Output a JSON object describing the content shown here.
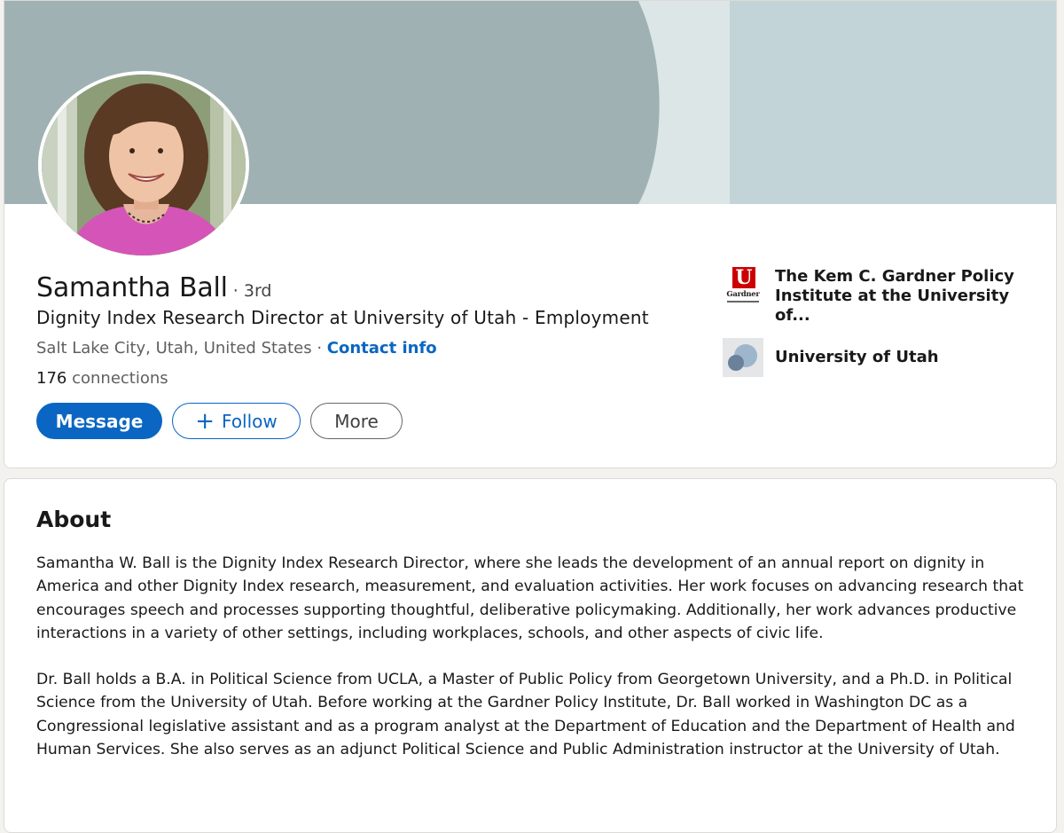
{
  "profile": {
    "name": "Samantha Ball",
    "degree": "· 3rd",
    "headline": "Dignity Index Research Director at University of Utah - Employment",
    "location": "Salt Lake City, Utah, United States",
    "separator": " · ",
    "contact_label": "Contact info",
    "connections_count": "176",
    "connections_label": "connections"
  },
  "actions": {
    "message_label": "Message",
    "follow_label": "Follow",
    "more_label": "More"
  },
  "orgs": [
    {
      "name": "The Kem C. Gardner Policy Institute at the University of...",
      "logo_text": "Gardner",
      "logo_letter": "U",
      "logo_icon": "university-of-utah-gardner-logo"
    },
    {
      "name": "University of Utah",
      "logo_icon": "university-logo"
    }
  ],
  "about": {
    "title": "About",
    "paragraphs": [
      "Samantha W. Ball is the Dignity Index Research Director, where she leads the development of an annual report on dignity in America and other Dignity Index research, measurement, and evaluation activities. Her work focuses on advancing research that encourages speech and processes supporting thoughtful, deliberative policymaking. Additionally, her work advances productive interactions in a variety of other settings, including workplaces, schools, and other aspects of civic life.",
      "Dr. Ball holds a B.A. in Political Science from UCLA, a Master of Public Policy from Georgetown University, and a Ph.D. in Political Science from the University of Utah. Before working at the Gardner Policy Institute, Dr. Ball worked in Washington DC as a Congressional legislative assistant and as a program analyst at the Department of Education and the Department of Health and Human Services. She also serves as an adjunct Political Science and Public Administration instructor at the University of Utah."
    ]
  },
  "colors": {
    "accent": "#0a66c2",
    "banner_dark": "#a0b1b4",
    "banner_light": "#c2d4d7",
    "banner_stripe": "#dde6e7",
    "utah_red": "#cc0000"
  }
}
